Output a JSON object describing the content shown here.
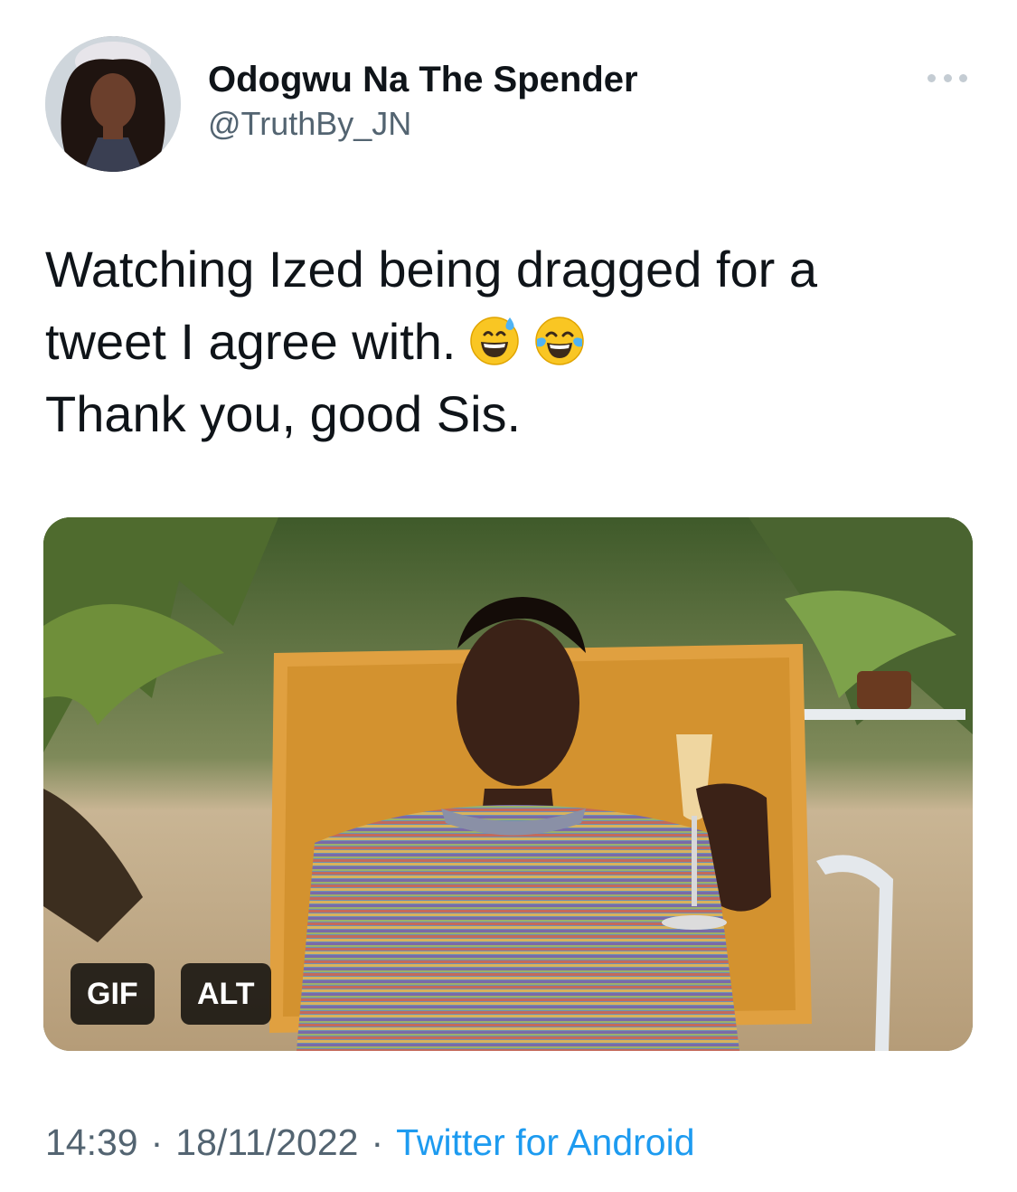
{
  "author": {
    "display_name": "Odogwu Na The Spender",
    "handle": "@TruthBy_JN"
  },
  "tweet": {
    "line1": "Watching Ized being dragged for a",
    "line2": "tweet I agree with.",
    "line3": "Thank you, good Sis.",
    "emojis": [
      "grinning-face-with-sweat-icon",
      "face-with-tears-of-joy-icon"
    ]
  },
  "media": {
    "badge_gif": "GIF",
    "badge_alt": "ALT"
  },
  "meta": {
    "time": "14:39",
    "separator": "·",
    "date": "18/11/2022",
    "source": "Twitter for Android"
  },
  "colors": {
    "text": "#0f1419",
    "secondary": "#536471",
    "link": "#1d9bf0"
  }
}
